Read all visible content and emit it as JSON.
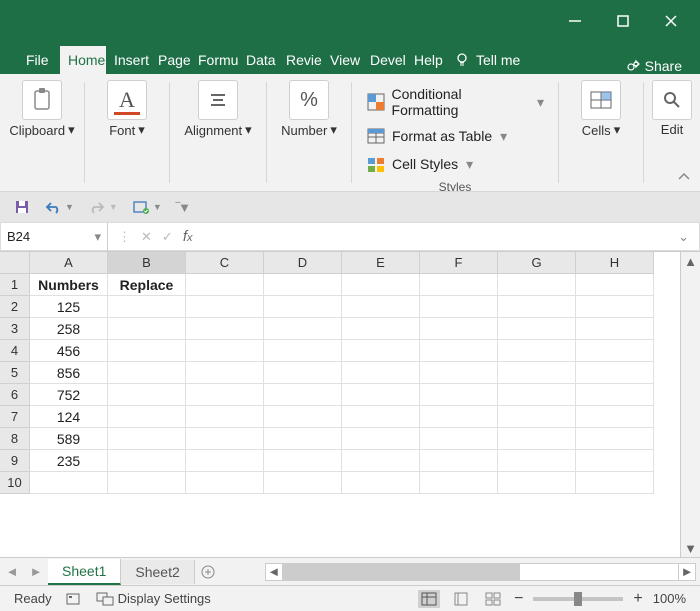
{
  "window": {
    "title": ""
  },
  "tabs": [
    "File",
    "Home",
    "Insert",
    "Page",
    "Formu",
    "Data",
    "Revie",
    "View",
    "Devel",
    "Help"
  ],
  "tellme": "Tell me",
  "share": "Share",
  "ribbon": {
    "clipboard": "Clipboard",
    "font": "Font",
    "alignment": "Alignment",
    "number": "Number",
    "cond_fmt": "Conditional Formatting",
    "as_table": "Format as Table",
    "cell_styles": "Cell Styles",
    "styles": "Styles",
    "cells": "Cells",
    "editing": "Edit"
  },
  "namebox": "B24",
  "fx_value": "",
  "columns": [
    "A",
    "B",
    "C",
    "D",
    "E",
    "F",
    "G",
    "H"
  ],
  "selected_col": "B",
  "data": {
    "headers": [
      "Numbers",
      "Replace"
    ],
    "rows": [
      125,
      258,
      456,
      856,
      752,
      124,
      589,
      235
    ]
  },
  "sheets": [
    "Sheet1",
    "Sheet2"
  ],
  "active_sheet": 0,
  "status": {
    "ready": "Ready",
    "display": "Display Settings",
    "zoom": "100%"
  }
}
